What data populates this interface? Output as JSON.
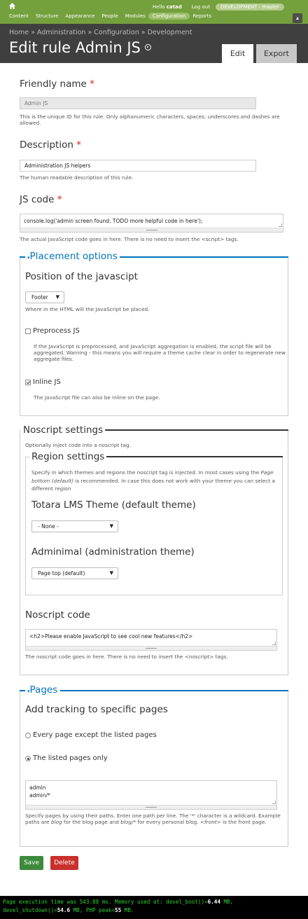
{
  "toolbar": {
    "hello_prefix": "Hello ",
    "username": "catad",
    "logout": "Log out",
    "environment": "DEVELOPMENT - master",
    "menu": [
      "Content",
      "Structure",
      "Appearance",
      "People",
      "Modules",
      "Configuration",
      "Reports"
    ],
    "active_menu": "Configuration"
  },
  "header": {
    "breadcrumb": [
      "Home",
      "Administration",
      "Configuration",
      "Development"
    ],
    "breadcrumb_separator": " » ",
    "title": "Edit rule Admin JS",
    "tabs": {
      "edit": "Edit",
      "export": "Export"
    }
  },
  "form": {
    "friendly_name": {
      "label": "Friendly name",
      "value": "Admin JS",
      "description": "This is the unique ID for this rule. Only alphanumeric characters, spaces, underscores and dashes are allowed."
    },
    "description": {
      "label": "Description",
      "value": "Administration JS helpers",
      "description": "The human readable description of this rule."
    },
    "js_code": {
      "label": "JS code",
      "value": "console.log('admin screen found. TODO more helpful code in here');",
      "description": "The actual JavaScript code goes in here. There is no need to insert the <script> tags."
    },
    "required_marker": "*"
  },
  "placement": {
    "legend": "Placement options",
    "position_heading": "Position of the javascipt",
    "position_value": "Footer",
    "position_description": "Where in the HTML will the JavaScript be placed.",
    "preprocess_label": "Preprocess JS",
    "preprocess_checked": false,
    "preprocess_description": "If the JavaScript is preprocessed, and JavaScript aggregation is enabled, the script file will be aggregated. Warning - this means you will require a theme cache clear in order to regenerate new aggregate files.",
    "inline_label": "Inline JS",
    "inline_checked": true,
    "inline_description": "The JavaScript file can also be inline on the page."
  },
  "noscript": {
    "legend": "Noscript settings",
    "intro": "Optionally inject code into a noscript tag.",
    "region_legend": "Region settings",
    "region_text_1": "Specify in which themes and regions the noscript tag is injected. In most cases using the ",
    "region_text_em": "Page bottom (default)",
    "region_text_2": " is recommended. In case this does not work with your theme you can select a different region",
    "theme1_heading": "Totara LMS Theme (default theme)",
    "theme1_value": "- None -",
    "theme2_heading": "Adminimal (administration theme)",
    "theme2_value": "Page top (default)",
    "code_heading": "Noscript code",
    "code_value": "<h2>Please enable JavaScript to see cool new features</h2>",
    "code_description": "The noscript code goes in here. There is no need to insert the <noscript> tags."
  },
  "pages": {
    "legend": "Pages",
    "heading": "Add tracking to specific pages",
    "option_except": "Every page except the listed pages",
    "option_listed": "The listed pages only",
    "selected_option": "The listed pages only",
    "list_line_1": "admin",
    "list_line_2": "admin/*",
    "desc_1": "Specify pages by using their paths. Enter one path per line. The '*' character is a wildcard. Example paths are ",
    "desc_em1": "blog",
    "desc_2": " for the blog page and ",
    "desc_em2": "blog/*",
    "desc_3": " for every personal blog. ",
    "desc_em3": "<front>",
    "desc_4": " is the front page."
  },
  "actions": {
    "save": "Save",
    "delete": "Delete"
  },
  "footer": {
    "line1_a": "Page execution time was 543.88 ms. Memory used at: devel_boot()=",
    "line1_b": "6.44",
    "line1_c": " MB,",
    "line2_a": "devel_shutdown()=",
    "line2_b": "54.6",
    "line2_c": " MB, PHP peak=",
    "line2_d": "55",
    "line2_e": " MB."
  },
  "colors": {
    "toolbar": "#74a03d",
    "header": "#3f3f3f",
    "link": "#0074bd",
    "required": "#d9241e",
    "save": "#3c8a3c",
    "delete": "#c9302c"
  },
  "icons": [
    "home-icon",
    "toolbar-toggle-icon",
    "shortcut-star-icon",
    "triangle-down-icon"
  ]
}
